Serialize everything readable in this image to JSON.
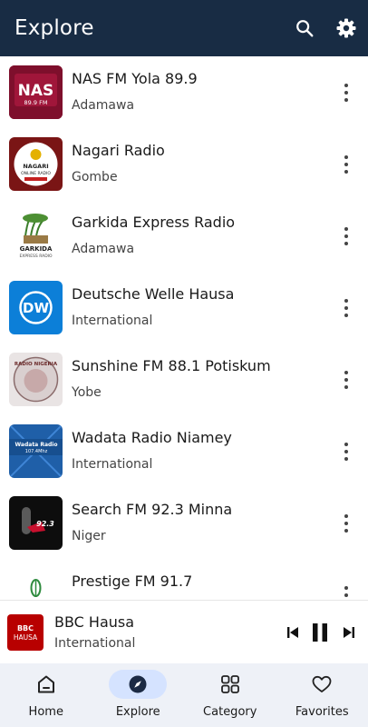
{
  "header": {
    "title": "Explore"
  },
  "stations": [
    {
      "name": "NAS FM Yola 89.9",
      "region": "Adamawa",
      "logo": {
        "big": "NAS",
        "small": "89.9 FM"
      }
    },
    {
      "name": "Nagari Radio",
      "region": "Gombe",
      "logo": {
        "big": "NAGARI",
        "small": "ONLINE RADIO"
      }
    },
    {
      "name": "Garkida Express Radio",
      "region": "Adamawa",
      "logo": {
        "big": "GARKIDA",
        "small": "EXPRESS RADIO"
      }
    },
    {
      "name": "Deutsche Welle Hausa",
      "region": "International",
      "logo": {
        "big": "DW",
        "small": ""
      }
    },
    {
      "name": " Sunshine FM 88.1 Potiskum",
      "region": "Yobe",
      "logo": {
        "big": "RADIO NIGERIA",
        "small": ""
      }
    },
    {
      "name": "Wadata Radio Niamey",
      "region": "International",
      "logo": {
        "big": "Wadata Radio",
        "small": "107.4Mhz"
      }
    },
    {
      "name": "Search FM 92.3 Minna",
      "region": "Niger",
      "logo": {
        "big": "92.3",
        "small": ""
      }
    },
    {
      "name": "Prestige FM 91.7",
      "region": "",
      "logo": {
        "big": "",
        "small": ""
      }
    }
  ],
  "player": {
    "name": "BBC Hausa",
    "region": "International",
    "logo": {
      "top": "BBC",
      "bottom": "HAUSA"
    }
  },
  "nav": [
    {
      "label": "Home",
      "icon": "home-icon"
    },
    {
      "label": "Explore",
      "icon": "compass-icon",
      "active": true
    },
    {
      "label": "Category",
      "icon": "category-icon"
    },
    {
      "label": "Favorites",
      "icon": "heart-icon"
    }
  ],
  "colors": {
    "appbar": "#182c44",
    "active_pill": "#d5e3ff",
    "nav_bg": "#eef1f7",
    "dw_blue": "#0c7fd8",
    "bbc_red": "#b80000"
  }
}
